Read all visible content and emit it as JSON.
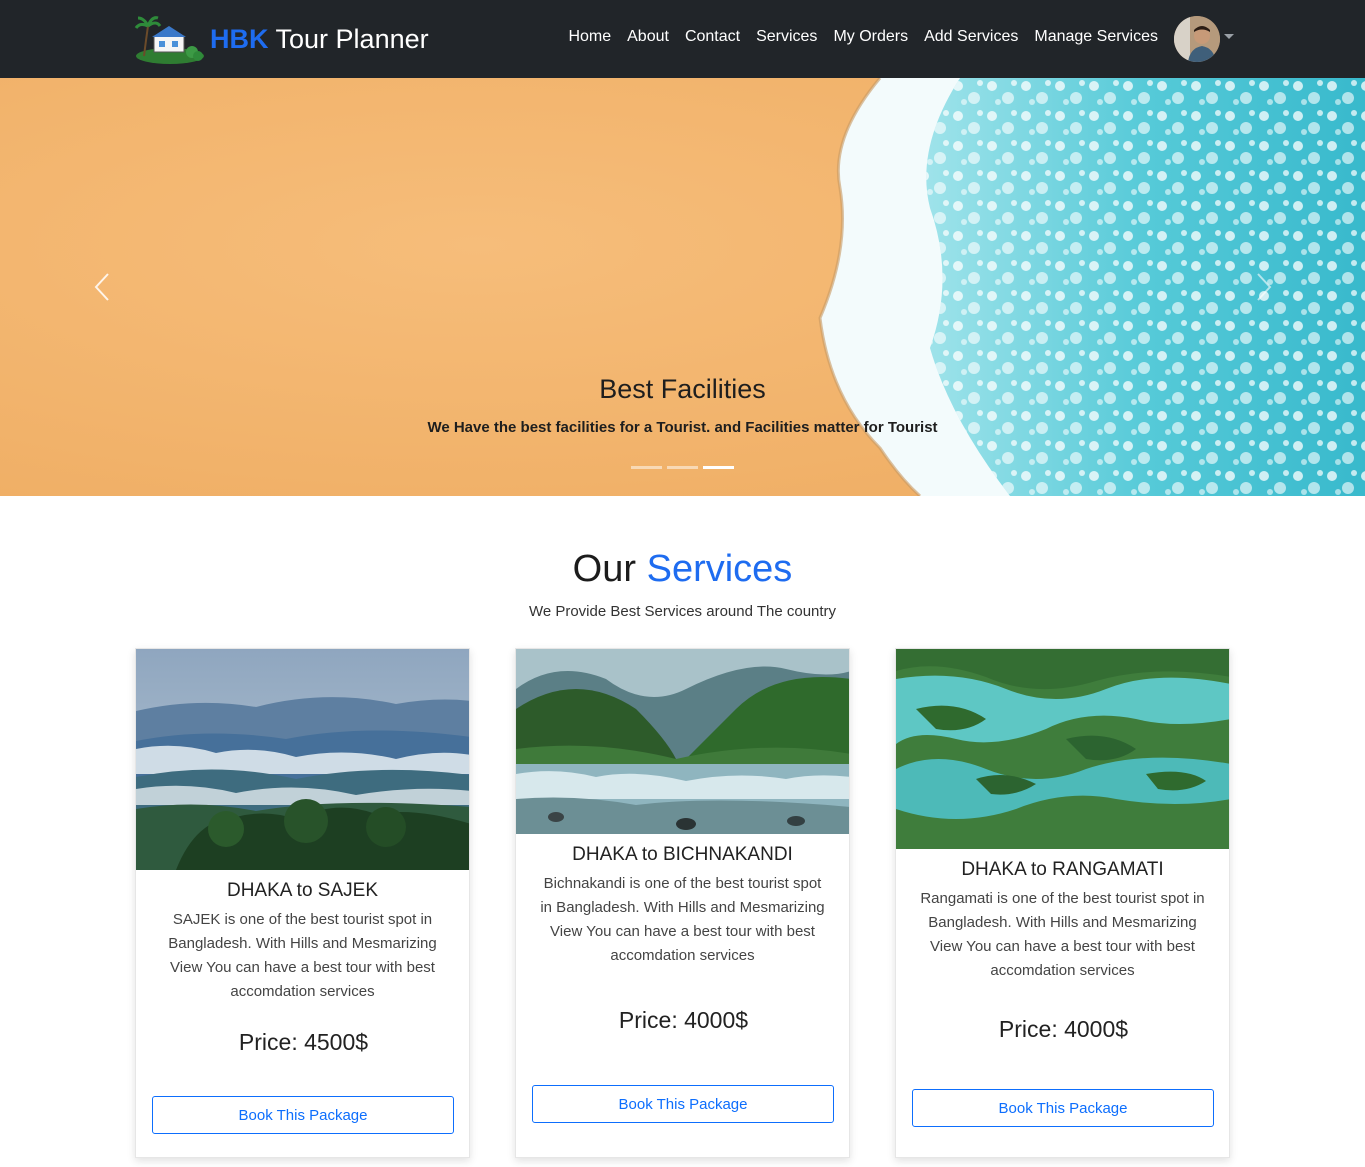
{
  "brand": {
    "accent": "HBK",
    "rest": "Tour Planner"
  },
  "nav": {
    "links": [
      "Home",
      "About",
      "Contact",
      "Services",
      "My Orders",
      "Add Services",
      "Manage Services"
    ]
  },
  "carousel": {
    "title": "Best Facilities",
    "text": "We Have the best facilities for a Tourist. and Facilities matter for Tourist",
    "slide_count": 3,
    "active_slide": 3
  },
  "services": {
    "title_a": "Our",
    "title_b": "Services",
    "subtitle": "We Provide Best Services around The country",
    "cards": [
      {
        "title": "DHAKA to SAJEK",
        "description": "SAJEK is one of the best tourist spot in Bangladesh. With Hills and Mesmarizing View You can have a best tour with best accomdation services",
        "price": "Price: 4500$",
        "button": "Book This Package"
      },
      {
        "title": "DHAKA to BICHNAKANDI",
        "description": "Bichnakandi is one of the best tourist spot in Bangladesh. With Hills and Mesmarizing View You can have a best tour with best accomdation services",
        "price": "Price: 4000$",
        "button": "Book This Package"
      },
      {
        "title": "DHAKA to RANGAMATI",
        "description": "Rangamati is one of the best tourist spot in Bangladesh. With Hills and Mesmarizing View You can have a best tour with best accomdation services",
        "price": "Price: 4000$",
        "button": "Book This Package"
      }
    ]
  },
  "colors": {
    "navbar_bg": "#212529",
    "brand_accent": "#1e6cf0",
    "button_primary": "#0d6efd",
    "sand": "#f2b36e",
    "sea": "#4fc9d6"
  },
  "icons": [
    "logo-icon",
    "avatar",
    "chevron-left-icon",
    "chevron-right-icon",
    "caret-down-icon"
  ]
}
